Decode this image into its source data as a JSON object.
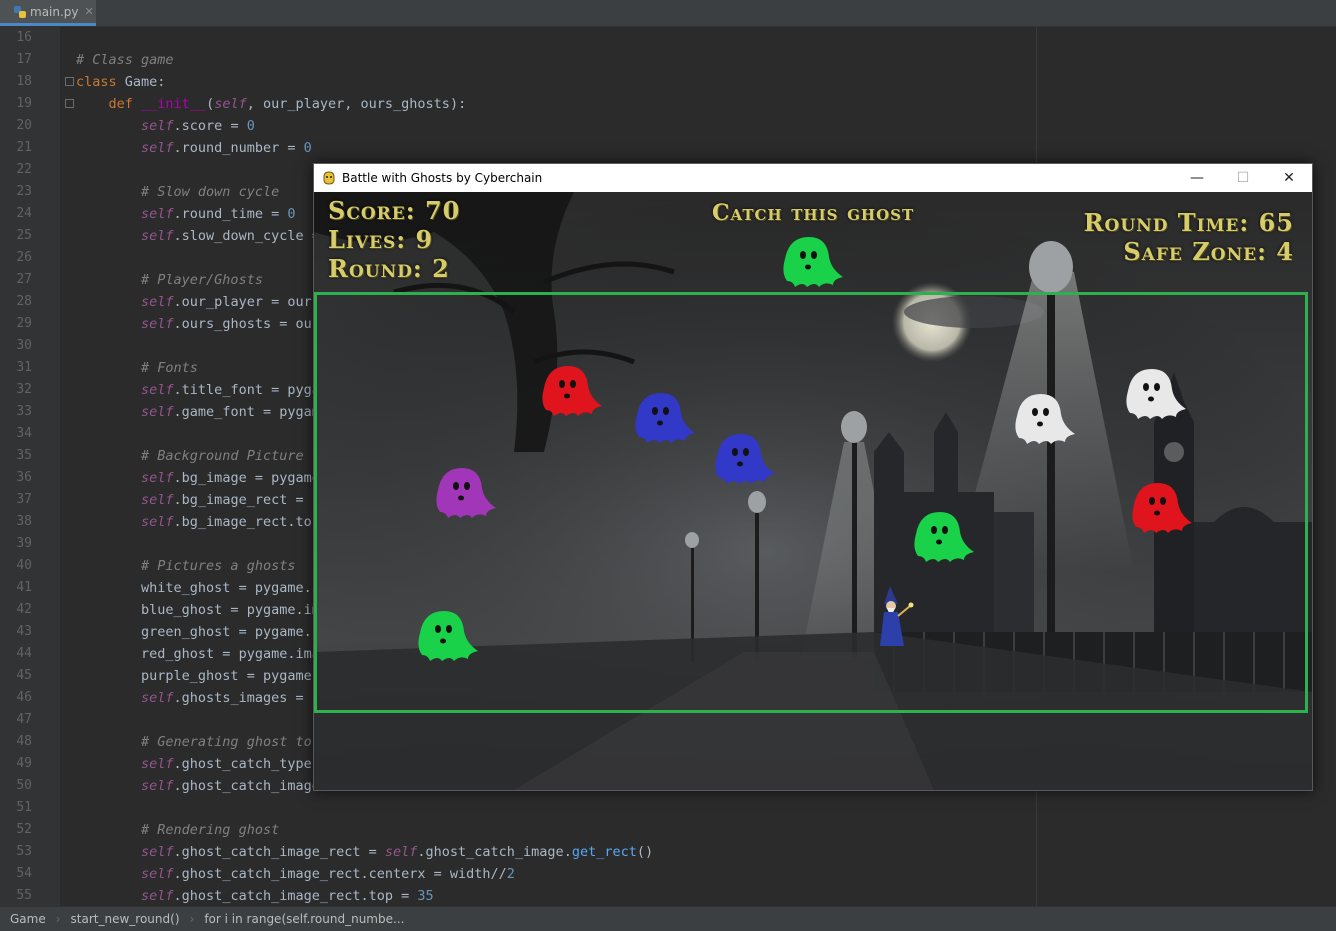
{
  "ide": {
    "tab": {
      "filename": "main.py",
      "icon": "python-file-icon"
    },
    "line_numbers": [
      "16",
      "17",
      "18",
      "19",
      "20",
      "21",
      "22",
      "23",
      "24",
      "25",
      "26",
      "27",
      "28",
      "29",
      "30",
      "31",
      "32",
      "33",
      "34",
      "35",
      "36",
      "37",
      "38",
      "39",
      "40",
      "41",
      "42",
      "43",
      "44",
      "45",
      "46",
      "47",
      "48",
      "49",
      "50",
      "51",
      "52",
      "53",
      "54",
      "55"
    ],
    "status_breadcrumbs": [
      "Game",
      "start_new_round()",
      "for i in range(self.round_numbe..."
    ]
  },
  "code": {
    "l17": "# Class game",
    "l18_kw": "class",
    "l18_name": "Game",
    "l18_rest": ":",
    "l19_def": "def",
    "l19_fn": "__init__",
    "l19_open": "(",
    "l19_self": "self",
    "l19_params": ", our_player, ours_ghosts",
    "l19_close": "):",
    "l20_self": "self",
    "l20_rest": ".score = ",
    "l20_num": "0",
    "l21_self": "self",
    "l21_rest": ".round_number = ",
    "l21_num": "0",
    "l23": "# Slow down cycle",
    "l24_self": "self",
    "l24_rest": ".round_time = ",
    "l24_num": "0",
    "l25_self": "self",
    "l25_rest": ".slow_down_cycle =",
    "l27": "# Player/Ghosts",
    "l28_self": "self",
    "l28_rest": ".our_player = our",
    "l29_self": "self",
    "l29_rest": ".ours_ghosts = our",
    "l31": "# Fonts",
    "l32_self": "self",
    "l32_rest": ".title_font = pyga",
    "l33_self": "self",
    "l33_rest": ".game_font = pygam",
    "l35": "# Background Picture",
    "l36_self": "self",
    "l36_rest": ".bg_image = pygame",
    "l37_self": "self",
    "l37_rest": ".bg_image_rect = s",
    "l38_self": "self",
    "l38_rest": ".bg_image_rect.top",
    "l40": "# Pictures a ghosts",
    "l41": "white_ghost = pygame.i",
    "l42": "blue_ghost = pygame.im",
    "l43": "green_ghost = pygame.i",
    "l44": "red_ghost = pygame.ima",
    "l45": "purple_ghost = pygame.",
    "l46_self": "self",
    "l46_rest": ".ghosts_images = [",
    "l48": "# Generating ghost to",
    "l49_self": "self",
    "l49_rest": ".ghost_catch_type",
    "l50_self": "self",
    "l50_rest": ".ghost_catch_image",
    "l52": "# Rendering ghost",
    "l53_self": "self",
    "l53_rest": ".ghost_catch_image_rect = ",
    "l53_self2": "self",
    "l53_rest2": ".ghost_catch_image.",
    "l53_mth": "get_rect",
    "l53_end": "()",
    "l54_self": "self",
    "l54_rest": ".ghost_catch_image_rect.centerx = width//",
    "l54_num": "2",
    "l55_self": "self",
    "l55_rest": ".ghost_catch_image_rect.top = ",
    "l55_num": "35"
  },
  "game_window": {
    "title": "Battle with Ghosts by Cyberchain",
    "controls": {
      "minimize": "—",
      "maximize": "☐",
      "close": "✕"
    },
    "hud": {
      "score": "Score: 70",
      "lives": "Lives: 9",
      "round": "Round: 2",
      "catch_label": "Catch this ghost",
      "round_time": "Round Time: 65",
      "safe_zone": "Safe Zone: 4"
    },
    "target_ghost_color": "green",
    "ghosts_on_field": [
      "red",
      "blue",
      "blue",
      "purple",
      "green",
      "green",
      "white",
      "white",
      "red"
    ],
    "colors": {
      "green": "#19d24a",
      "red": "#e0141c",
      "blue": "#3238c8",
      "purple": "#a236b8",
      "white": "#e8e8e8",
      "hud_text": "#d8cc6a",
      "safe_zone_border": "#2fb04e"
    }
  }
}
